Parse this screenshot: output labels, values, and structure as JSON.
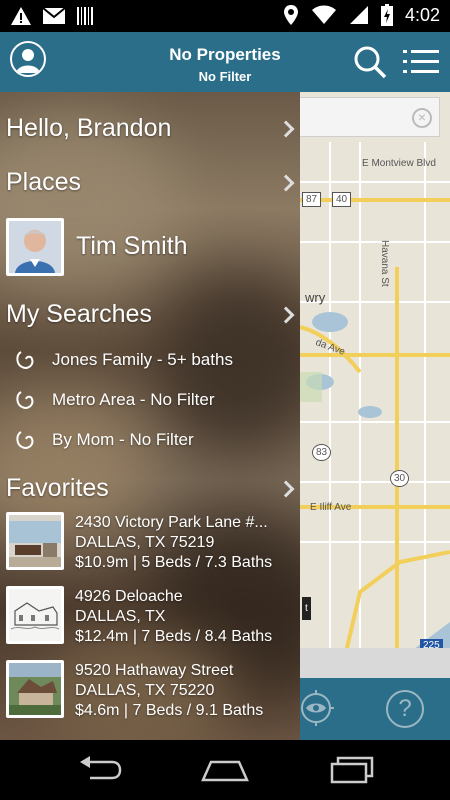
{
  "status_bar": {
    "time": "4:02",
    "icons": [
      "warning-icon",
      "gmail-icon",
      "barcode-icon",
      "location-icon",
      "wifi-icon",
      "cellular-icon",
      "battery-charging-icon"
    ]
  },
  "header": {
    "title": "No Properties",
    "subtitle": "No Filter",
    "icons": [
      "avatar-icon",
      "search-icon",
      "list-menu-icon"
    ]
  },
  "drawer": {
    "greeting": "Hello, Brandon",
    "places_label": "Places",
    "agent_name": "Tim Smith",
    "my_searches_label": "My Searches",
    "searches": [
      {
        "label": "Jones Family - 5+ baths"
      },
      {
        "label": "Metro Area - No Filter"
      },
      {
        "label": "By Mom - No Filter"
      }
    ],
    "favorites_label": "Favorites",
    "favorites": [
      {
        "address": "2430 Victory Park Lane #...",
        "city": "DALLAS, TX 75219",
        "details": "$10.9m | 5 Beds / 7.3 Baths"
      },
      {
        "address": "4926 Deloache",
        "city": "DALLAS, TX",
        "details": "$12.4m | 7 Beds / 8.4 Baths"
      },
      {
        "address": "9520 Hathaway Street",
        "city": "DALLAS, TX 75220",
        "details": "$4.6m | 7 Beds / 9.1 Baths"
      }
    ]
  },
  "map": {
    "labels": {
      "street1": "E Montview Blvd",
      "street2": "Havana St",
      "street3": "E Iliff Ave",
      "area": "wry",
      "ave": "da Ave",
      "shield_287": "87",
      "shield_40": "40",
      "shield_83": "83",
      "shield_30": "30",
      "shield_225": "225",
      "fragment": "t"
    }
  },
  "map_toolbar": {
    "icons": [
      "target-eye-icon",
      "help-icon"
    ],
    "help_glyph": "?"
  },
  "nav_bar": {
    "icons": [
      "back-icon",
      "home-icon",
      "recent-apps-icon"
    ]
  },
  "colors": {
    "header": "#2b6e8a",
    "map_bg": "#e9e4d8",
    "road_yellow": "#f2cf5a"
  }
}
